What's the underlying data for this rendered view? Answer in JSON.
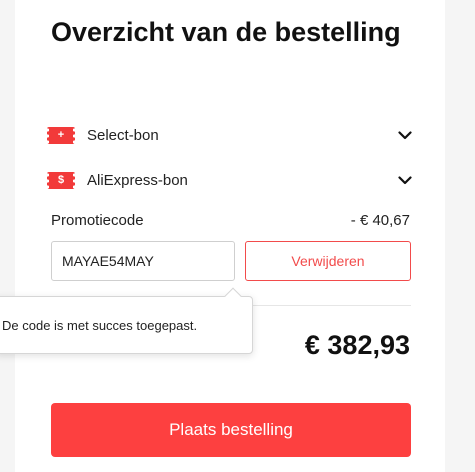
{
  "summary": {
    "title": "Overzicht van de bestelling",
    "coupons": [
      {
        "label": "Select-bon",
        "icon": "ticket-plus-icon",
        "icon_glyph": "+"
      },
      {
        "label": "AliExpress-bon",
        "icon": "ticket-dollar-icon",
        "icon_glyph": "$"
      }
    ],
    "promo": {
      "label": "Promotiecode",
      "discount": "- € 40,67",
      "code_value": "MAYAE54MAY",
      "remove_label": "Verwijderen"
    },
    "tooltip_text": "De code is met succes toegepast.",
    "total": "€ 382,93",
    "place_order_label": "Plaats bestelling"
  },
  "colors": {
    "accent": "#fd4040",
    "coupon_icon": "#f23a3a"
  }
}
